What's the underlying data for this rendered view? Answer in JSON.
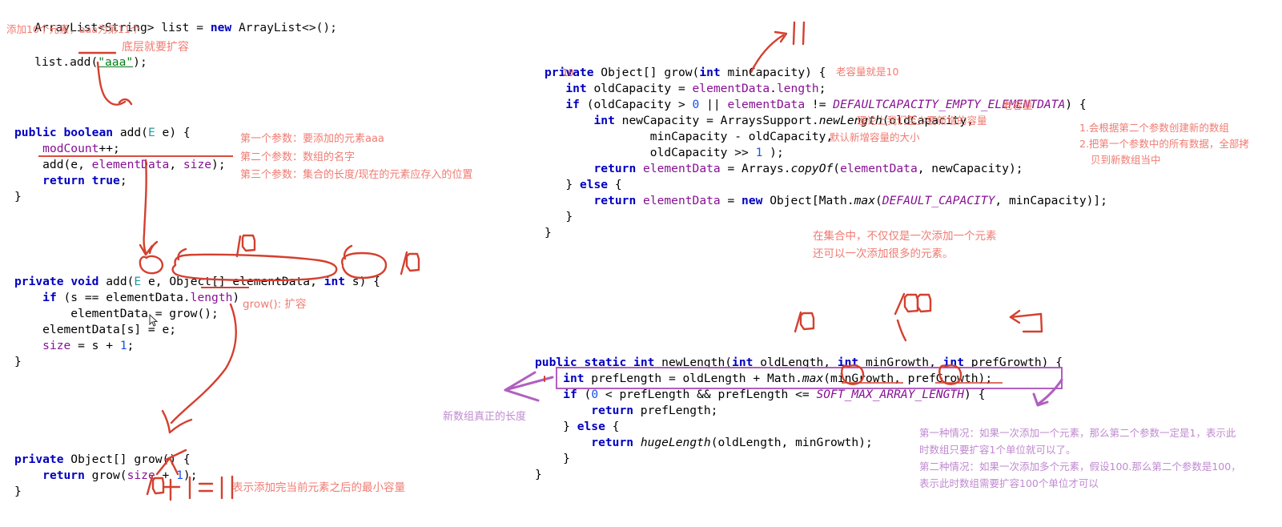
{
  "meta": {
    "colors": {
      "keyword": "#0000c0",
      "field": "#871094",
      "string": "#067d17",
      "number": "#1750eb",
      "annotation_red": "#f07b72",
      "annotation_purple": "#c08ad0",
      "ink_red": "#d4402f",
      "ink_purple": "#b05fc0",
      "background": "#ffffff"
    }
  },
  "usage_snippet": {
    "line1": "ArrayList<String> list = new ArrayList<>();",
    "comment1": "添加10个元素，aaa为第11个",
    "line2_prefix": "list.add(",
    "line2_string": "\"aaa\"",
    "line2_suffix": ");",
    "comment2": "底层就要扩容"
  },
  "add_public": {
    "sig": "public boolean add(E e) {",
    "body": [
      "modCount++;",
      "add(e, elementData, size);",
      "return true;"
    ],
    "close": "}",
    "notes": [
      "第一个参数：要添加的元素aaa",
      "第二个参数：数组的名字",
      "第三个参数：集合的长度/现在的元素应存入的位置"
    ]
  },
  "add_private": {
    "sig": "private void add(E e, Object[] elementData, int s) {",
    "body": [
      "if (s == elementData.length)",
      "elementData = grow();",
      "elementData[s] = e;",
      "size = s + 1;"
    ],
    "close": "}",
    "note_grow": "grow(): 扩容",
    "ink_ten": "10",
    "ink_ten2": "10"
  },
  "grow_noarg": {
    "sig": "private Object[] grow() {",
    "body": [
      "return grow(size + 1);"
    ],
    "close": "}",
    "ink_expr": "10 + 1 = 11",
    "note": "表示添加完当前元素之后的最小容量"
  },
  "grow_min": {
    "sig": "private Object[] grow(int minCapacity) {",
    "lineno": "10",
    "lines": [
      "int oldCapacity = elementData.length;",
      "if (oldCapacity > 0 || elementData != DEFAULTCAPACITY_EMPTY_ELEMENTDATA) {",
      "int newCapacity = ArraysSupport.newLength(oldCapacity,",
      "minCapacity - oldCapacity,",
      "oldCapacity >> 1 );",
      "return elementData = Arrays.copyOf(elementData, newCapacity);",
      "} else {",
      "return elementData = new Object[Math.max(DEFAULT_CAPACITY, minCapacity)];",
      "}",
      "}"
    ],
    "notes": {
      "old_cap": "老容量就是10",
      "old_cap2": "老容量",
      "min_grow": "理论上我们至少要新增的容量",
      "pref_grow": "默认新增容量的大小"
    },
    "ink_eleven": "11",
    "copyof_notes": [
      "1.会根据第二个参数创建新的数组",
      "2.把第一个参数中的所有数据，全部拷",
      "贝到新数组当中"
    ]
  },
  "collection_note": [
    "在集合中，不仅仅是一次添加一个元素",
    "还可以一次添加很多的元素。"
  ],
  "new_length": {
    "sig": "public static int newLength(int oldLength, int minGrowth, int prefGrowth) {",
    "lines": [
      "int prefLength = oldLength + Math.max(minGrowth, prefGrowth);",
      "if (0 < prefLength && prefLength <= SOFT_MAX_ARRAY_LENGTH) {",
      "return prefLength;",
      "} else {",
      "return hugeLength(oldLength, minGrowth);",
      "}",
      "}"
    ],
    "ink_ten": "10",
    "ink_hundred": "100",
    "pref_note": "新数组真正的长度",
    "case_notes": [
      "第一种情况：如果一次添加一个元素，那么第二个参数一定是1，表示此",
      "时数组只要扩容1个单位就可以了。",
      "第二种情况：如果一次添加多个元素，假设100.那么第二个参数是100，",
      "表示此时数组需要扩容100个单位才可以"
    ]
  }
}
